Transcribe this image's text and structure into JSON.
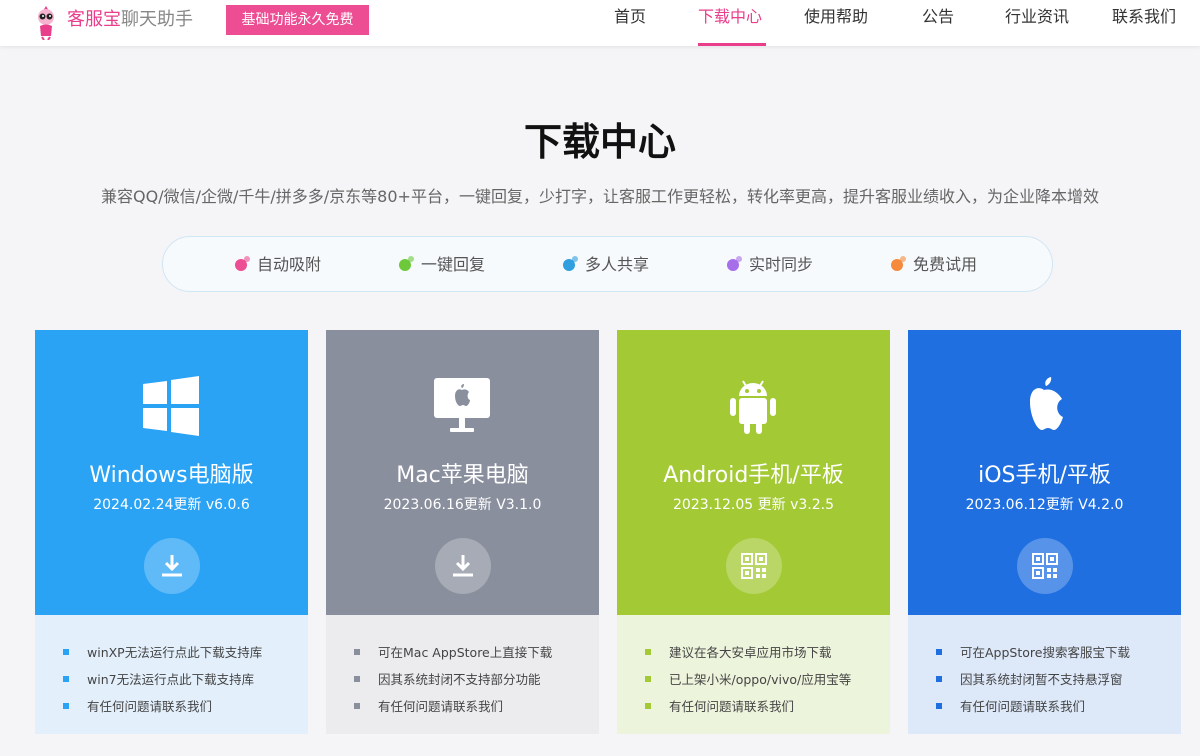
{
  "header": {
    "brand_pink": "客服宝",
    "brand_gray": "聊天助手",
    "badge": "基础功能永久免费",
    "nav": [
      "首页",
      "下载中心",
      "使用帮助",
      "公告",
      "行业资讯",
      "联系我们"
    ],
    "active_nav": "下载中心"
  },
  "hero": {
    "title": "下载中心",
    "subtitle": "兼容QQ/微信/企微/千牛/拼多多/京东等80+平台，一键回复，少打字，让客服工作更轻松，转化率更高，提升客服业绩收入，为企业降本增效"
  },
  "features": [
    {
      "label": "自动吸附",
      "color": "#ec4d93"
    },
    {
      "label": "一键回复",
      "color": "#6dc93a"
    },
    {
      "label": "多人共享",
      "color": "#2f9fe0"
    },
    {
      "label": "实时同步",
      "color": "#a66ee8"
    },
    {
      "label": "免费试用",
      "color": "#f58a3c"
    }
  ],
  "cards": [
    {
      "name": "Windows电脑版",
      "version": "2024.02.24更新 v6.0.6",
      "icon": "windows-icon",
      "action_icon": "download-icon",
      "top_color": "#2ba3f5",
      "bottom_color": "#e3f0fc",
      "bullet_color": "#2ba3f5",
      "notes": [
        "winXP无法运行点此下载支持库",
        "win7无法运行点此下载支持库",
        "有任何问题请联系我们"
      ]
    },
    {
      "name": "Mac苹果电脑",
      "version": "2023.06.16更新 V3.1.0",
      "icon": "mac-icon",
      "action_icon": "download-icon",
      "top_color": "#8a8f9e",
      "bottom_color": "#ececef",
      "bullet_color": "#8a8f9e",
      "notes": [
        "可在Mac AppStore上直接下载",
        "因其系统封闭不支持部分功能",
        "有任何问题请联系我们"
      ]
    },
    {
      "name": "Android手机/平板",
      "version": "2023.12.05 更新 v3.2.5",
      "icon": "android-icon",
      "action_icon": "qrcode-icon",
      "top_color": "#a3c935",
      "bottom_color": "#edf4dc",
      "bullet_color": "#a3c935",
      "notes": [
        "建议在各大安卓应用市场下载",
        "已上架小米/oppo/vivo/应用宝等",
        "有任何问题请联系我们"
      ]
    },
    {
      "name": "iOS手机/平板",
      "version": "2023.06.12更新 V4.2.0",
      "icon": "apple-icon",
      "action_icon": "qrcode-icon",
      "top_color": "#1f6fe0",
      "bottom_color": "#dde8f9",
      "bullet_color": "#1f6fe0",
      "notes": [
        "可在AppStore搜索客服宝下载",
        "因其系统封闭暂不支持悬浮窗",
        "有任何问题请联系我们"
      ]
    }
  ]
}
